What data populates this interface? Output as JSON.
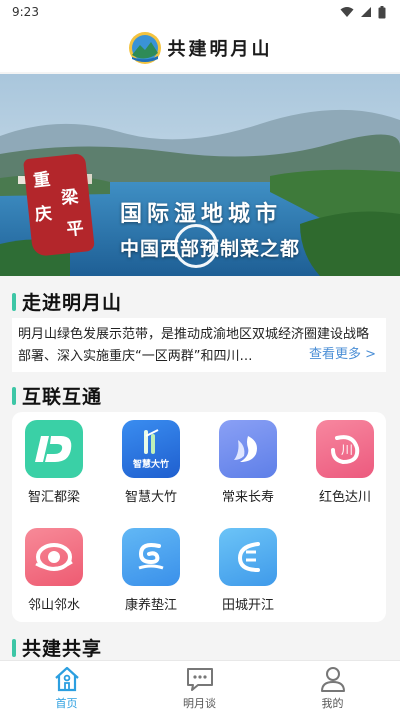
{
  "status_bar": {
    "time": "9:23"
  },
  "header": {
    "title": "共建明月山"
  },
  "banner": {
    "seal_chars": [
      "重",
      "庆",
      "梁",
      "平"
    ],
    "title": "国际湿地城市",
    "subtitle": "中国西部预制菜之都",
    "slide_count": 7,
    "active_slide": 1
  },
  "section_intro": {
    "title": "走进明月山",
    "text": "明月山绿色发展示范带，是推动成渝地区双城经济圈建设战略部署、深入实施重庆“一区两群”和四川…",
    "more_label": "查看更多 >"
  },
  "section_links": {
    "title": "互联互通",
    "items": [
      {
        "label": "智汇都梁",
        "icon": "zhihui-duliang-icon",
        "color": "#3ad0a6",
        "glyph": "D"
      },
      {
        "label": "智慧大竹",
        "icon": "zhihui-dazhu-icon",
        "color": "#2f7fe8",
        "glyph": "智慧大竹"
      },
      {
        "label": "常来长寿",
        "icon": "changlai-changshou-icon",
        "color": "#6f8df2",
        "glyph": "寿"
      },
      {
        "label": "红色达川",
        "icon": "hongse-dachuan-icon",
        "color": "#f06c8d",
        "glyph": "川"
      },
      {
        "label": "邻山邻水",
        "icon": "linshan-linshui-icon",
        "color": "#f0647c",
        "glyph": "水"
      },
      {
        "label": "康养垫江",
        "icon": "kangyang-dianjiang-icon",
        "color": "#4aa6f0",
        "glyph": "江"
      },
      {
        "label": "田城开江",
        "icon": "tiancheng-kaijiang-icon",
        "color": "#52b6f2",
        "glyph": "开"
      }
    ]
  },
  "section_share": {
    "title": "共建共享"
  },
  "bottom_nav": {
    "items": [
      {
        "label": "首页",
        "icon": "home-icon",
        "active": true
      },
      {
        "label": "明月谈",
        "icon": "chat-icon",
        "active": false
      },
      {
        "label": "我的",
        "icon": "profile-icon",
        "active": false
      }
    ]
  },
  "colors": {
    "accent": "#3dc6a6",
    "nav_active": "#2c9fe0",
    "link": "#4c8fd6",
    "seal_red": "#b3262b"
  }
}
